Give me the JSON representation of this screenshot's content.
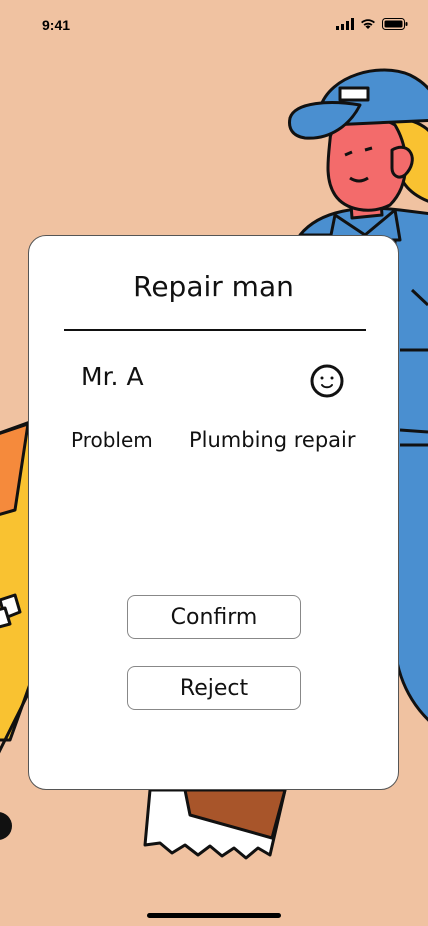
{
  "status_bar": {
    "time": "9:41"
  },
  "card": {
    "title": "Repair man",
    "name": "Mr. A",
    "problem_label": "Problem",
    "problem_value": "Plumbing repair",
    "confirm_label": "Confirm",
    "reject_label": "Reject"
  },
  "colors": {
    "background": "#F0C2A1",
    "card": "#FFFFFF",
    "shirt_blue": "#4A8FD0",
    "face": "#F36B6B",
    "hair": "#F9C231"
  },
  "icons": [
    "signal-icon",
    "wifi-icon",
    "battery-icon",
    "smile-icon"
  ]
}
